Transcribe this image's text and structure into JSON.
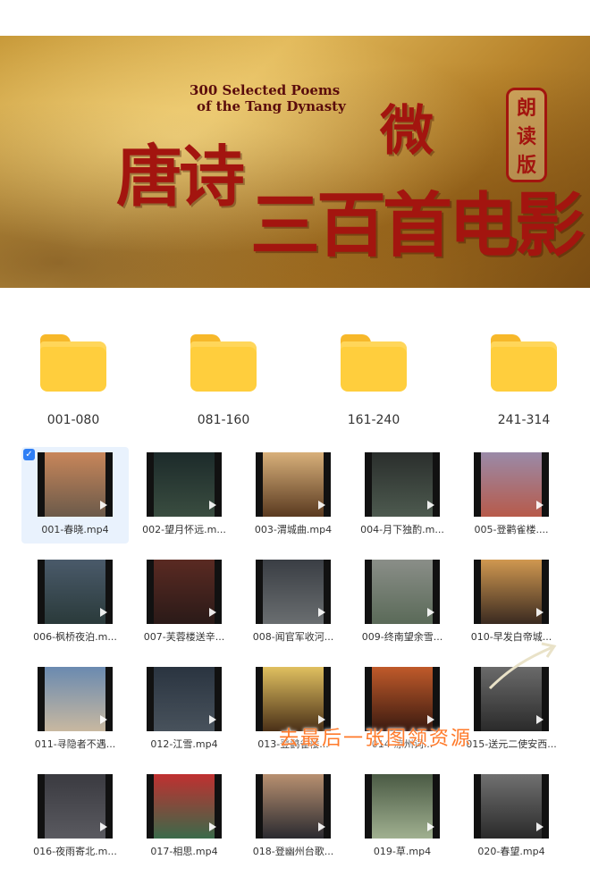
{
  "banner": {
    "en_line1": "300 Selected Poems",
    "en_line2": "of the Tang Dynasty",
    "cn_part1": "唐诗",
    "cn_part2": "三百首电影",
    "cn_part3": "微",
    "seal": "朗读版"
  },
  "folders": [
    {
      "label": "001-080",
      "icon": "folder-icon"
    },
    {
      "label": "081-160",
      "icon": "folder-icon"
    },
    {
      "label": "161-240",
      "icon": "folder-icon"
    },
    {
      "label": "241-314",
      "icon": "folder-icon"
    }
  ],
  "videos": [
    {
      "name": "001-春晓.mp4",
      "selected": true
    },
    {
      "name": "002-望月怀远.m...",
      "selected": false
    },
    {
      "name": "003-渭城曲.mp4",
      "selected": false
    },
    {
      "name": "004-月下独酌.m...",
      "selected": false
    },
    {
      "name": "005-登鹳雀楼....",
      "selected": false
    },
    {
      "name": "006-枫桥夜泊.m...",
      "selected": false
    },
    {
      "name": "007-芙蓉楼送辛...",
      "selected": false
    },
    {
      "name": "008-闻官军收河...",
      "selected": false
    },
    {
      "name": "009-终南望余雪...",
      "selected": false
    },
    {
      "name": "010-早发白帝城...",
      "selected": false
    },
    {
      "name": "011-寻隐者不遇...",
      "selected": false
    },
    {
      "name": "012-江雪.mp4",
      "selected": false
    },
    {
      "name": "013-登鹳雀楼...",
      "selected": false
    },
    {
      "name": "014-凉州词...",
      "selected": false
    },
    {
      "name": "015-送元二使安西...",
      "selected": false
    },
    {
      "name": "016-夜雨寄北.m...",
      "selected": false
    },
    {
      "name": "017-相思.mp4",
      "selected": false
    },
    {
      "name": "018-登幽州台歌...",
      "selected": false
    },
    {
      "name": "019-草.mp4",
      "selected": false
    },
    {
      "name": "020-春望.mp4",
      "selected": false
    }
  ],
  "promo": "去最后一张图领资源",
  "colors": {
    "accent": "#2f7ff5",
    "folder": "#ffce3d",
    "promo": "#ff7a2a",
    "title_red": "#a3150f"
  }
}
